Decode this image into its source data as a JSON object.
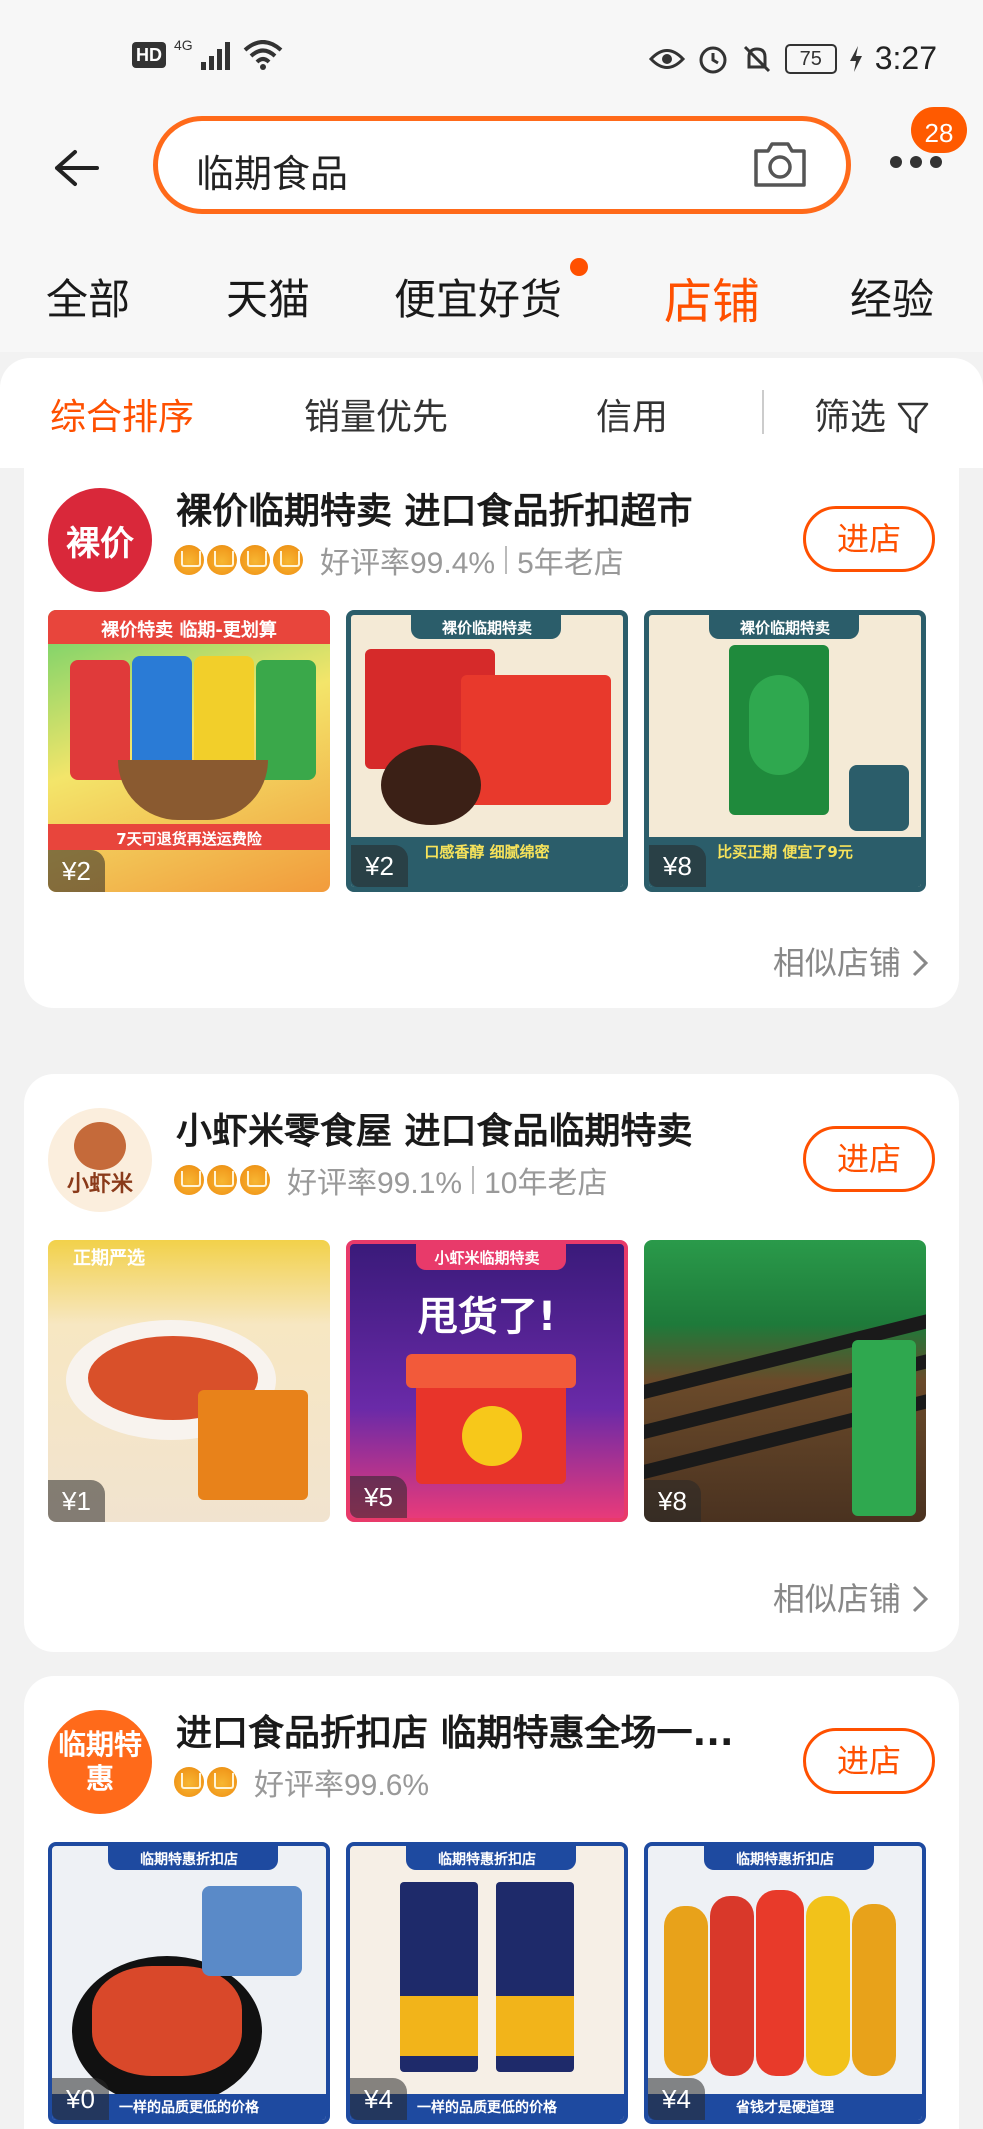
{
  "status_bar": {
    "hd": "HD",
    "network": "4G",
    "battery": "75",
    "time": "3:27"
  },
  "search": {
    "query": "临期食品",
    "message_count": "28"
  },
  "tabs": [
    {
      "label": "全部"
    },
    {
      "label": "天猫"
    },
    {
      "label": "便宜好货"
    },
    {
      "label": "店铺"
    },
    {
      "label": "经验"
    }
  ],
  "sort": {
    "comprehensive": "综合排序",
    "sales": "销量优先",
    "credit": "信用",
    "filter": "筛选"
  },
  "shops": [
    {
      "logo_text": "裸价",
      "name": "裸价临期特卖 进口食品折扣超市",
      "crowns": 4,
      "rating": "好评率99.4%",
      "age": "5年老店",
      "enter": "进店",
      "products": [
        {
          "price": "¥2",
          "banner": "裸价特卖 临期-更划算",
          "tagline": "7天可退货再送运费险"
        },
        {
          "price": "¥2",
          "banner": "裸价临期特卖",
          "tagline": "口感香醇 细腻绵密"
        },
        {
          "price": "¥8",
          "banner": "裸价临期特卖",
          "tagline": "比买正期 便宜了9元"
        }
      ],
      "similar": "相似店铺"
    },
    {
      "logo_text": "小虾米",
      "name": "小虾米零食屋 进口食品临期特卖",
      "crowns": 3,
      "rating": "好评率99.1%",
      "age": "10年老店",
      "enter": "进店",
      "products": [
        {
          "price": "¥1",
          "banner": "正期严选"
        },
        {
          "price": "¥5",
          "banner": "小虾米临期特卖",
          "tagline": "甩货了!"
        },
        {
          "price": "¥8",
          "banner": ""
        }
      ],
      "similar": "相似店铺"
    },
    {
      "logo_text": "临期特惠",
      "name": "进口食品折扣店 临期特惠全场一...",
      "crowns": 2,
      "rating": "好评率99.6%",
      "age": "",
      "enter": "进店",
      "products": [
        {
          "price": "¥0",
          "banner": "临期特惠折扣店",
          "tagline": "一样的品质更低的价格"
        },
        {
          "price": "¥4",
          "banner": "临期特惠折扣店",
          "tagline": "一样的品质更低的价格"
        },
        {
          "price": "¥4",
          "banner": "临期特惠折扣店",
          "tagline": "省钱才是硬道理"
        }
      ]
    }
  ]
}
